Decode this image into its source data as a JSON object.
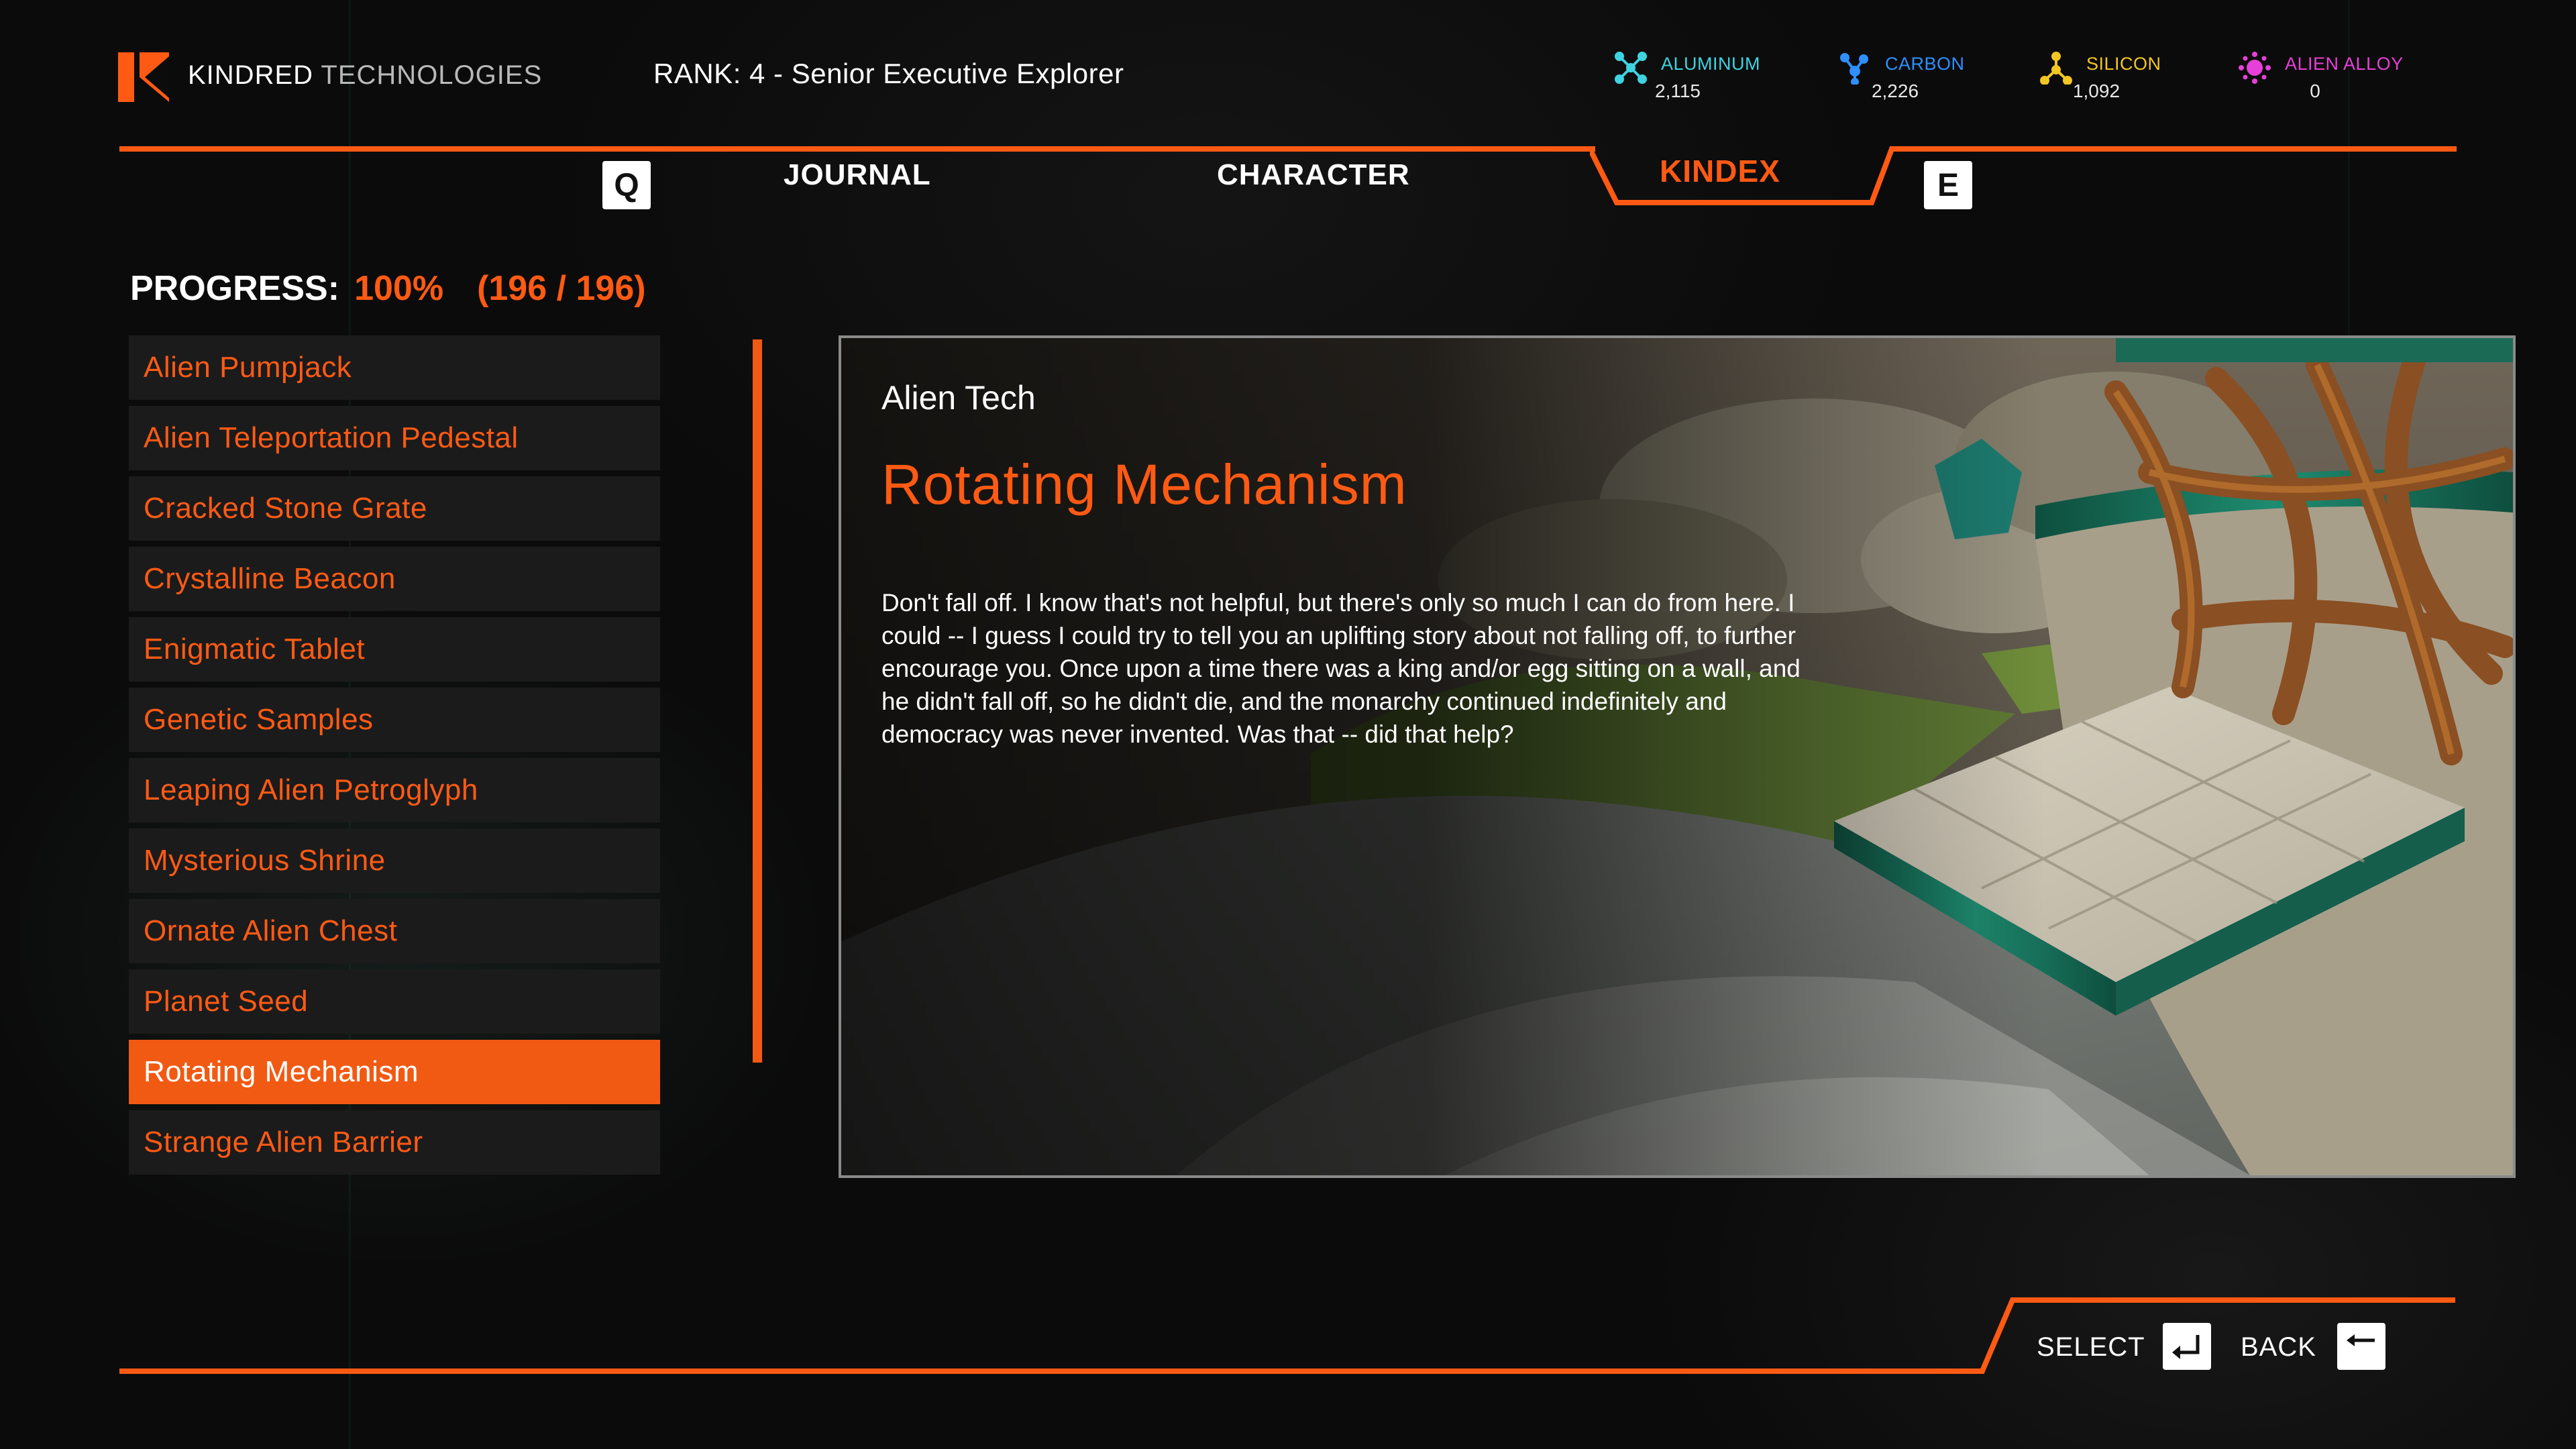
{
  "header": {
    "brand_primary": "KINDRED",
    "brand_secondary": "TECHNOLOGIES",
    "rank_label": "RANK:",
    "rank_value": "4 - Senior Executive Explorer"
  },
  "resources": [
    {
      "name": "ALUMINUM",
      "value": "2,115",
      "color": "#3fd3e0",
      "icon": "aluminum-icon"
    },
    {
      "name": "CARBON",
      "value": "2,226",
      "color": "#2f8fff",
      "icon": "carbon-icon"
    },
    {
      "name": "SILICON",
      "value": "1,092",
      "color": "#f3c623",
      "icon": "silicon-icon"
    },
    {
      "name": "ALIEN ALLOY",
      "value": "0",
      "color": "#e640d8",
      "icon": "alien-alloy-icon"
    }
  ],
  "nav": {
    "prev_key": "Q",
    "next_key": "E",
    "tabs": [
      {
        "label": "JOURNAL",
        "active": false
      },
      {
        "label": "CHARACTER",
        "active": false
      },
      {
        "label": "KINDEX",
        "active": true
      }
    ]
  },
  "progress": {
    "label": "PROGRESS:",
    "percent": "100%",
    "count": "(196 / 196)"
  },
  "list": [
    {
      "label": "Alien Pumpjack",
      "selected": false
    },
    {
      "label": "Alien Teleportation Pedestal",
      "selected": false
    },
    {
      "label": "Cracked Stone Grate",
      "selected": false
    },
    {
      "label": "Crystalline Beacon",
      "selected": false
    },
    {
      "label": "Enigmatic Tablet",
      "selected": false
    },
    {
      "label": "Genetic Samples",
      "selected": false
    },
    {
      "label": "Leaping Alien Petroglyph",
      "selected": false
    },
    {
      "label": "Mysterious Shrine",
      "selected": false
    },
    {
      "label": "Ornate Alien Chest",
      "selected": false
    },
    {
      "label": "Planet Seed",
      "selected": false
    },
    {
      "label": "Rotating Mechanism",
      "selected": true
    },
    {
      "label": "Strange Alien Barrier",
      "selected": false
    }
  ],
  "detail": {
    "category": "Alien Tech",
    "title": "Rotating Mechanism",
    "description": "Don't fall off. I know that's not helpful, but there's only so much I can do from here. I could -- I guess I could try to tell you an uplifting story about not falling off, to further encourage you. Once upon a time there was a king and/or egg sitting on a wall, and he didn't fall off, so he didn't die, and the monarchy continued indefinitely and democracy was never invented. Was that -- did that help?"
  },
  "footer": {
    "select_label": "SELECT",
    "back_label": "BACK"
  },
  "colors": {
    "accent": "#ff5a14",
    "selected_bg": "#f15a13"
  }
}
